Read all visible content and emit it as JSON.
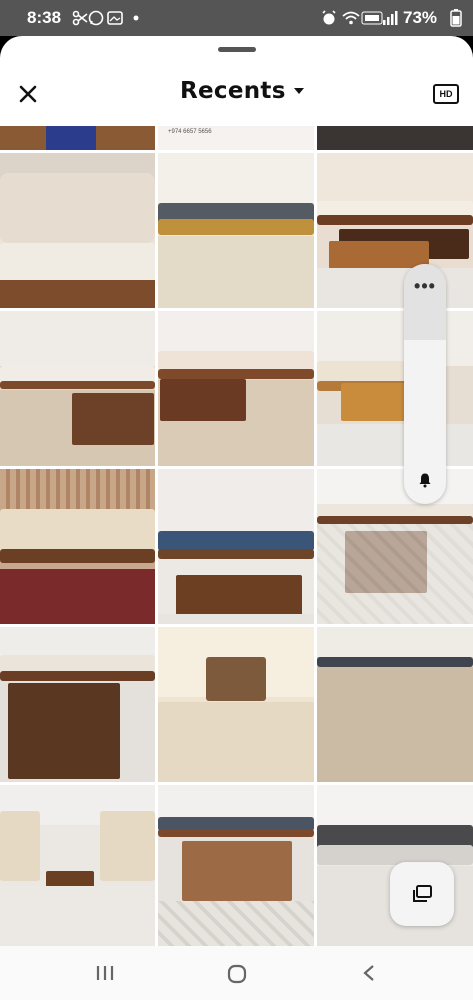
{
  "status_bar": {
    "time": "8:38",
    "battery": "73%",
    "left_icons": [
      "scissors-icon",
      "whatsapp-icon",
      "gallery-icon",
      "dot-icon"
    ],
    "right_icons": [
      "alarm-icon",
      "wifi-icon",
      "volte-lte2-icon",
      "signal-icon"
    ]
  },
  "header": {
    "title": "Recents",
    "hd_label": "HD",
    "close_icon": "close-icon",
    "dropdown_icon": "caret-down-icon"
  },
  "gallery": {
    "thumbnails": [
      "photo 1",
      "photo 2",
      "photo 3",
      "photo 4",
      "photo 5",
      "photo 6",
      "photo 7",
      "photo 8",
      "photo 9",
      "photo 10",
      "photo 11",
      "photo 12",
      "photo 13",
      "photo 14",
      "photo 15",
      "photo 16",
      "photo 17",
      "photo 18"
    ],
    "partial_top_text": "+974 6657 5656"
  },
  "scroller": {
    "menu_icon": "more-dots-icon",
    "bell_icon": "bell-icon"
  },
  "album_button_icon": "folder-icon",
  "nav": {
    "recents_icon": "recent-apps-icon",
    "home_icon": "home-icon",
    "back_icon": "back-icon"
  },
  "colors": {
    "sheet_bg": "#ffffff",
    "status_bar_bg": "#555555",
    "wood": "#7a4a2b",
    "carpet": "#d9cbb5",
    "sofa_cream": "#efe7da",
    "sofa_blue": "#3a5478"
  }
}
